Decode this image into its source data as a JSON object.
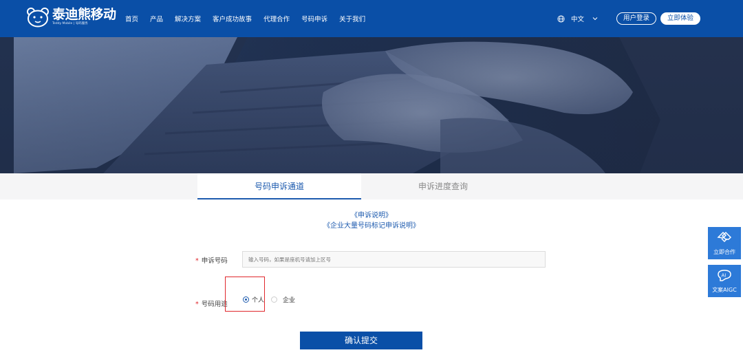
{
  "header": {
    "logo_cn": "泰迪熊移动",
    "logo_en": "Teddy Mobile | 号码服务",
    "nav": [
      "首页",
      "产品",
      "解决方案",
      "客户成功故事",
      "代理合作",
      "号码申诉",
      "关于我们"
    ],
    "lang_label": "中文",
    "login_label": "用户登录",
    "try_label": "立即体验"
  },
  "tabs": {
    "active": "号码申诉通道",
    "inactive": "申诉进度查询"
  },
  "notes": {
    "link1": "《申诉说明》",
    "link2": "《企业大量号码标记申诉说明》"
  },
  "form": {
    "required_mark": "*",
    "phone_label": "申诉号码",
    "phone_placeholder": "输入号码，如果是座机号请加上区号",
    "usage_label": "号码用途",
    "usage_options": [
      "个人",
      "企业"
    ],
    "usage_selected": "个人",
    "submit_label": "确认提交"
  },
  "side": {
    "cooperate_label": "立即合作",
    "aigc_label": "文案AIGC"
  },
  "colors": {
    "brand_blue": "#0a4fa7",
    "link_blue": "#1c5aae",
    "float_blue": "#2d7ad8",
    "required_red": "#e0262b"
  }
}
